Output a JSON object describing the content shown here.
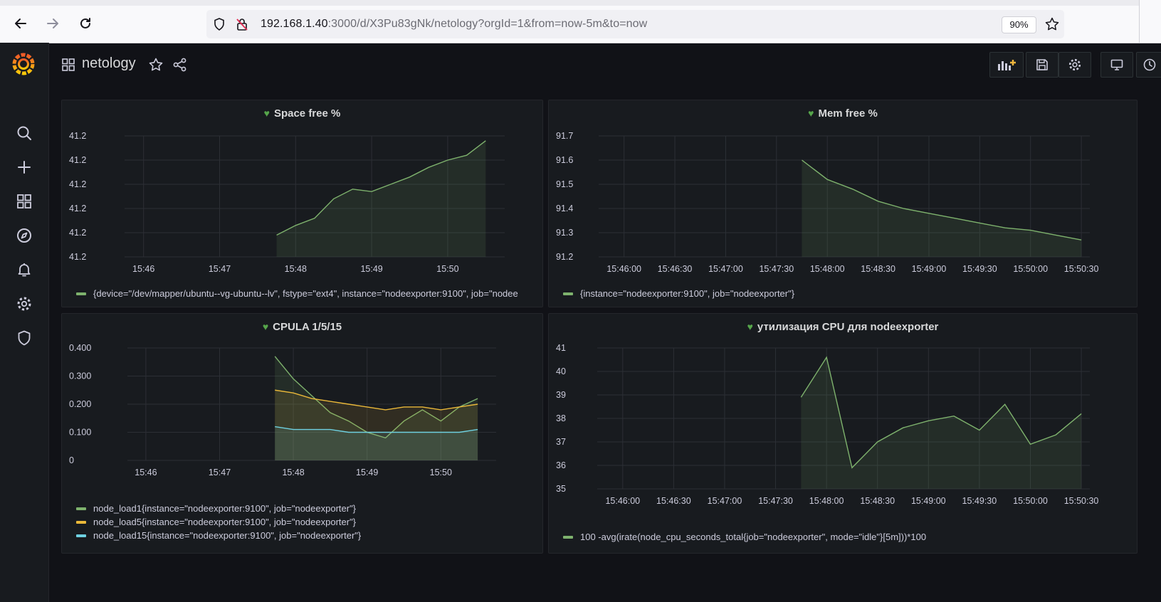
{
  "browser": {
    "url_host": "192.168.1.40",
    "url_rest": ":3000/d/X3Pu83gNk/netology?orgId=1&from=now-5m&to=now",
    "zoom": "90%"
  },
  "header": {
    "title": "netology"
  },
  "colors": {
    "green": "#7eb26d",
    "orange": "#eab839",
    "cyan": "#6ed0e0",
    "heart": "#56a64b"
  },
  "panels": [
    {
      "title": "Space free %",
      "legend": [
        "{device=\"/dev/mapper/ubuntu--vg-ubuntu--lv\", fstype=\"ext4\", instance=\"nodeexporter:9100\", job=\"nodee"
      ]
    },
    {
      "title": "Mem free %",
      "legend": [
        "{instance=\"nodeexporter:9100\", job=\"nodeexporter\"}"
      ]
    },
    {
      "title": "CPULA 1/5/15",
      "legend": [
        "node_load1{instance=\"nodeexporter:9100\", job=\"nodeexporter\"}",
        "node_load5{instance=\"nodeexporter:9100\", job=\"nodeexporter\"}",
        "node_load15{instance=\"nodeexporter:9100\", job=\"nodeexporter\"}"
      ]
    },
    {
      "title": "утилизация CPU для nodeexporter",
      "legend": [
        "100 -avg(irate(node_cpu_seconds_total{job=\"nodeexporter\", mode=\"idle\"}[5m]))*100"
      ]
    }
  ],
  "chart_data": [
    {
      "type": "area",
      "title": "Space free %",
      "x_ticks": [
        "15:46",
        "15:47",
        "15:48",
        "15:49",
        "15:50"
      ],
      "y_ticks": [
        "41.2",
        "41.2",
        "41.2",
        "41.2",
        "41.2",
        "41.2"
      ],
      "ylim": [
        0,
        5
      ],
      "x_range": [
        "15:45:45",
        "15:50:45"
      ],
      "series": [
        {
          "name": "{device=\"/dev/mapper/ubuntu--vg-ubuntu--lv\", fstype=\"ext4\", instance=\"nodeexporter:9100\", job=\"nodee",
          "color": "#7eb26d",
          "x": [
            "15:47:45",
            "15:48",
            "15:48:15",
            "15:48:30",
            "15:48:45",
            "15:49",
            "15:49:15",
            "15:49:30",
            "15:49:45",
            "15:50",
            "15:50:15",
            "15:50:30"
          ],
          "values": [
            0.9,
            1.3,
            1.6,
            2.4,
            2.8,
            2.7,
            3.0,
            3.3,
            3.7,
            4.0,
            4.2,
            4.8
          ]
        }
      ],
      "grid": true,
      "legend": "bottom"
    },
    {
      "type": "area",
      "title": "Mem free %",
      "x_ticks": [
        "15:46:00",
        "15:46:30",
        "15:47:00",
        "15:47:30",
        "15:48:00",
        "15:48:30",
        "15:49:00",
        "15:49:30",
        "15:50:00",
        "15:50:30"
      ],
      "y_ticks": [
        "91.2",
        "91.3",
        "91.4",
        "91.5",
        "91.6",
        "91.7"
      ],
      "ylim": [
        91.2,
        91.7
      ],
      "x_range": [
        "15:45:45",
        "15:50:35"
      ],
      "series": [
        {
          "name": "{instance=\"nodeexporter:9100\", job=\"nodeexporter\"}",
          "color": "#7eb26d",
          "x": [
            "15:47:45",
            "15:48",
            "15:48:15",
            "15:48:30",
            "15:48:45",
            "15:49",
            "15:49:15",
            "15:49:30",
            "15:49:45",
            "15:50",
            "15:50:15",
            "15:50:30"
          ],
          "values": [
            91.6,
            91.52,
            91.48,
            91.43,
            91.4,
            91.38,
            91.36,
            91.34,
            91.32,
            91.31,
            91.29,
            91.27
          ]
        }
      ],
      "grid": true,
      "legend": "bottom"
    },
    {
      "type": "area",
      "title": "CPULA 1/5/15",
      "x_ticks": [
        "15:46",
        "15:47",
        "15:48",
        "15:49",
        "15:50"
      ],
      "y_ticks": [
        "0",
        "0.100",
        "0.200",
        "0.300",
        "0.400"
      ],
      "ylim": [
        0,
        0.4
      ],
      "x_range": [
        "15:45:45",
        "15:50:45"
      ],
      "series": [
        {
          "name": "node_load1{instance=\"nodeexporter:9100\", job=\"nodeexporter\"}",
          "color": "#7eb26d",
          "x": [
            "15:47:45",
            "15:48",
            "15:48:15",
            "15:48:30",
            "15:48:45",
            "15:49",
            "15:49:15",
            "15:49:30",
            "15:49:45",
            "15:50",
            "15:50:15",
            "15:50:30"
          ],
          "values": [
            0.37,
            0.29,
            0.23,
            0.17,
            0.14,
            0.1,
            0.08,
            0.14,
            0.18,
            0.14,
            0.19,
            0.22
          ]
        },
        {
          "name": "node_load5{instance=\"nodeexporter:9100\", job=\"nodeexporter\"}",
          "color": "#eab839",
          "x": [
            "15:47:45",
            "15:48",
            "15:48:15",
            "15:48:30",
            "15:48:45",
            "15:49",
            "15:49:15",
            "15:49:30",
            "15:49:45",
            "15:50",
            "15:50:15",
            "15:50:30"
          ],
          "values": [
            0.25,
            0.24,
            0.22,
            0.21,
            0.2,
            0.19,
            0.18,
            0.19,
            0.19,
            0.18,
            0.19,
            0.2
          ]
        },
        {
          "name": "node_load15{instance=\"nodeexporter:9100\", job=\"nodeexporter\"}",
          "color": "#6ed0e0",
          "x": [
            "15:47:45",
            "15:48",
            "15:48:15",
            "15:48:30",
            "15:48:45",
            "15:49",
            "15:49:15",
            "15:49:30",
            "15:49:45",
            "15:50",
            "15:50:15",
            "15:50:30"
          ],
          "values": [
            0.12,
            0.11,
            0.11,
            0.11,
            0.1,
            0.1,
            0.1,
            0.1,
            0.1,
            0.1,
            0.1,
            0.11
          ]
        }
      ],
      "grid": true,
      "legend": "bottom"
    },
    {
      "type": "area",
      "title": "утилизация CPU для nodeexporter",
      "x_ticks": [
        "15:46:00",
        "15:46:30",
        "15:47:00",
        "15:47:30",
        "15:48:00",
        "15:48:30",
        "15:49:00",
        "15:49:30",
        "15:50:00",
        "15:50:30"
      ],
      "y_ticks": [
        "35",
        "36",
        "37",
        "38",
        "39",
        "40",
        "41"
      ],
      "ylim": [
        35,
        41
      ],
      "x_range": [
        "15:45:45",
        "15:50:35"
      ],
      "series": [
        {
          "name": "100 -avg(irate(node_cpu_seconds_total{job=\"nodeexporter\", mode=\"idle\"}[5m]))*100",
          "color": "#7eb26d",
          "x": [
            "15:47:45",
            "15:48",
            "15:48:15",
            "15:48:30",
            "15:48:45",
            "15:49",
            "15:49:15",
            "15:49:30",
            "15:49:45",
            "15:50",
            "15:50:15",
            "15:50:30"
          ],
          "values": [
            38.9,
            40.6,
            35.9,
            37.0,
            37.6,
            37.9,
            38.1,
            37.5,
            38.6,
            36.9,
            37.3,
            38.2
          ]
        }
      ],
      "grid": true,
      "legend": "bottom"
    }
  ]
}
